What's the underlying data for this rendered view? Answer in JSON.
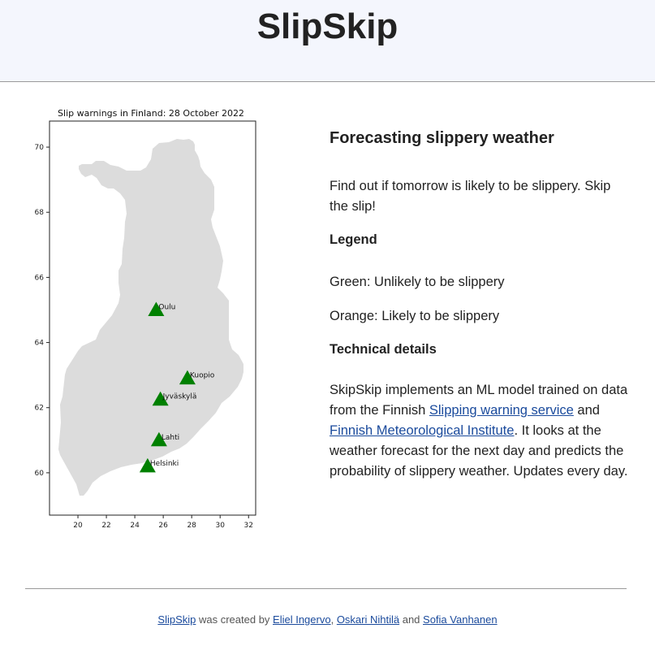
{
  "header": {
    "title": "SlipSkip"
  },
  "chart_data": {
    "type": "scatter",
    "title": "Slip warnings in Finland: 28 October 2022",
    "xlim": [
      18,
      32.5
    ],
    "ylim": [
      58.7,
      70.8
    ],
    "xticks": [
      20,
      22,
      24,
      26,
      28,
      30,
      32
    ],
    "yticks": [
      60,
      62,
      64,
      66,
      68,
      70
    ],
    "marker": "triangle",
    "marker_color": "#008000",
    "map_fill": "#dcdcdc",
    "points": [
      {
        "label": "Oulu",
        "x": 25.5,
        "y": 65.0
      },
      {
        "label": "Kuopio",
        "x": 27.7,
        "y": 62.9
      },
      {
        "label": "Jyväskylä",
        "x": 25.8,
        "y": 62.25
      },
      {
        "label": "Lahti",
        "x": 25.7,
        "y": 61.0
      },
      {
        "label": "Helsinki",
        "x": 24.9,
        "y": 60.2
      }
    ]
  },
  "content": {
    "heading": "Forecasting slippery weather",
    "intro": "Find out if tomorrow is likely to be slippery. Skip the slip!",
    "legend_heading": "Legend",
    "legend_green": "Green: Unlikely to be slippery",
    "legend_orange": "Orange: Likely to be slippery",
    "tech_heading": "Technical details",
    "tech_text_1": "SkipSkip implements an ML model trained on data from the Finnish ",
    "tech_link_1": "Slipping warning service",
    "tech_text_2": " and ",
    "tech_link_2": "Finnish Meteorological Institute",
    "tech_text_3": ". It looks at the weather forecast for the next day and predicts the probability of slippery weather. Updates every day."
  },
  "footer": {
    "app_link": "SlipSkip",
    "created_by": " was created by ",
    "author1": "Eliel Ingervo",
    "sep1": ", ",
    "author2": "Oskari Nihtilä",
    "sep2": " and ",
    "author3": "Sofia Vanhanen"
  },
  "colors": {
    "header_bg": "#f4f6fd",
    "link": "#1a4a9c"
  }
}
